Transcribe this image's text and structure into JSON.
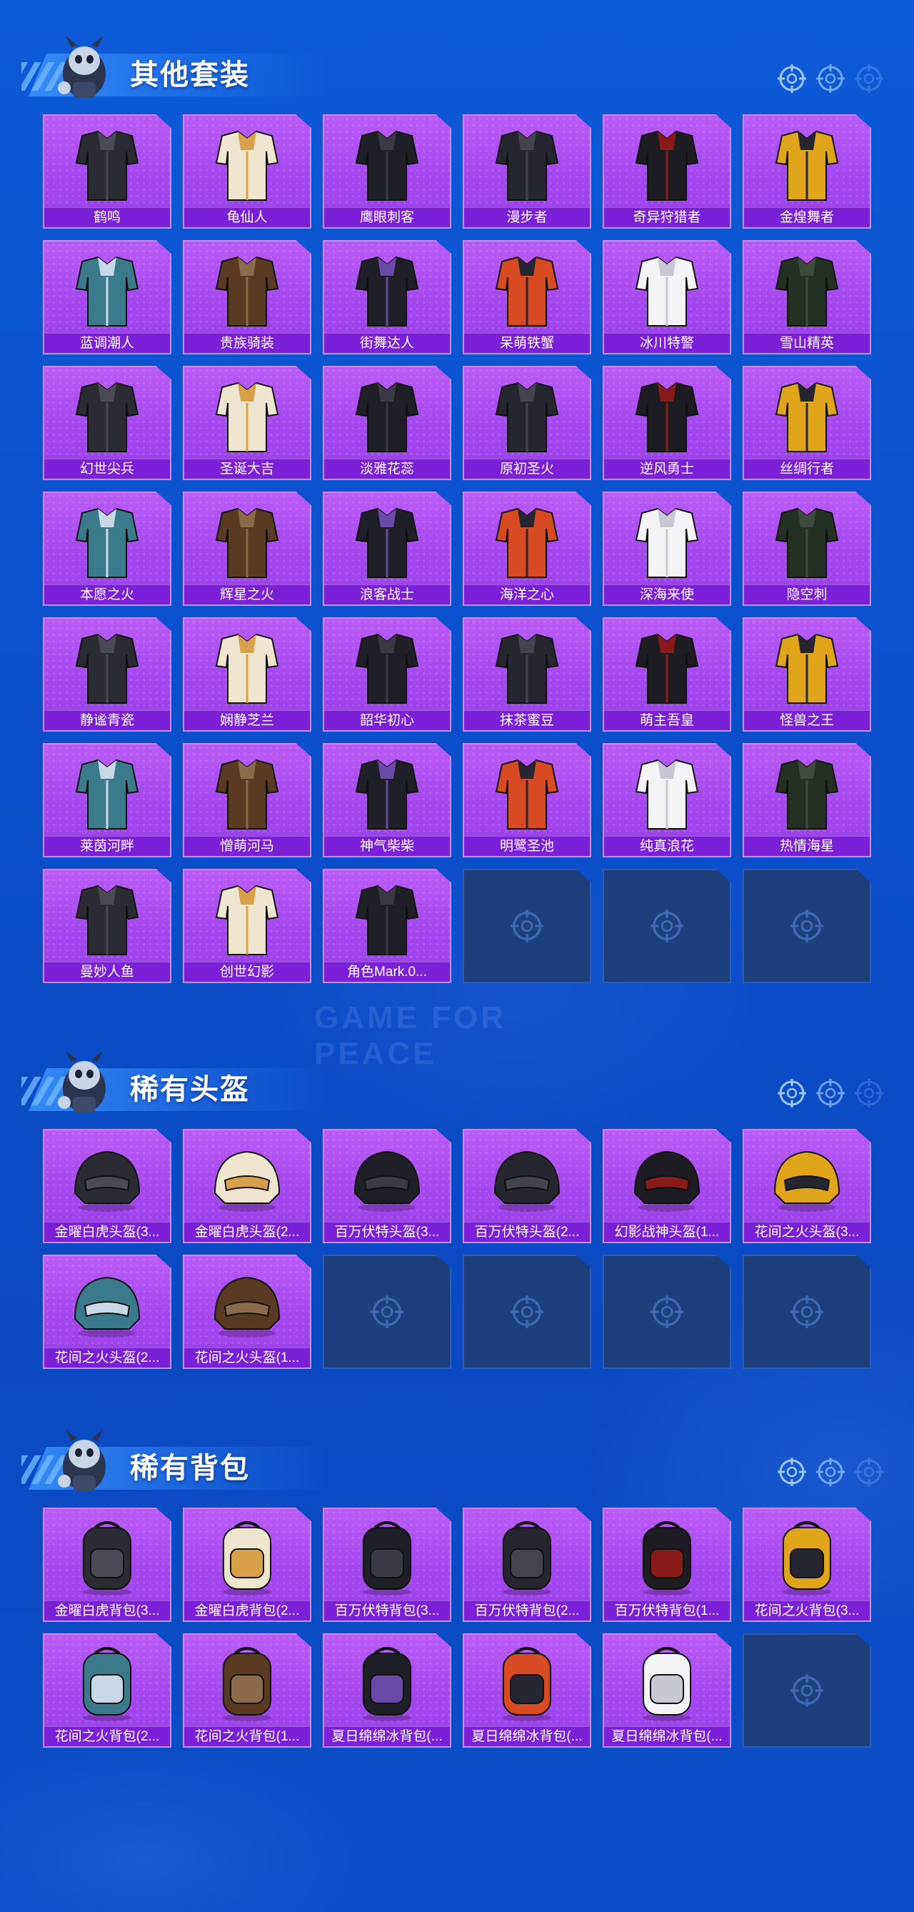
{
  "colors": {
    "background": "#0b4fcd",
    "card_bg": "#a448ee",
    "card_label_bg": "#7b1fd8",
    "card_border": "#c88cff",
    "empty_slot_bg": "#1d3f7c",
    "title_text": "#ffffff"
  },
  "sections": [
    {
      "title": "其他套装",
      "icons": [
        "crosshair-icon",
        "crosshair-icon",
        "crosshair-icon"
      ],
      "items": [
        {
          "label": "鹤鸣",
          "icon": "jacket-icon"
        },
        {
          "label": "龟仙人",
          "icon": "shirt-icon"
        },
        {
          "label": "鹰眼刺客",
          "icon": "outfit-icon"
        },
        {
          "label": "漫步者",
          "icon": "outfit-icon"
        },
        {
          "label": "奇异狩猎者",
          "icon": "outfit-icon"
        },
        {
          "label": "金煌舞者",
          "icon": "outfit-icon"
        },
        {
          "label": "蓝调潮人",
          "icon": "outfit-icon"
        },
        {
          "label": "贵族骑装",
          "icon": "outfit-icon"
        },
        {
          "label": "街舞达人",
          "icon": "outfit-icon"
        },
        {
          "label": "呆萌铁蟹",
          "icon": "outfit-icon"
        },
        {
          "label": "冰川特警",
          "icon": "outfit-icon"
        },
        {
          "label": "雪山精英",
          "icon": "outfit-icon"
        },
        {
          "label": "幻世尖兵",
          "icon": "outfit-icon"
        },
        {
          "label": "圣诞大吉",
          "icon": "outfit-icon"
        },
        {
          "label": "淡雅花蕊",
          "icon": "outfit-icon"
        },
        {
          "label": "原初圣火",
          "icon": "outfit-icon"
        },
        {
          "label": "逆风勇士",
          "icon": "outfit-icon"
        },
        {
          "label": "丝绸行者",
          "icon": "outfit-icon"
        },
        {
          "label": "本愿之火",
          "icon": "outfit-icon"
        },
        {
          "label": "辉星之火",
          "icon": "outfit-icon"
        },
        {
          "label": "浪客战士",
          "icon": "outfit-icon"
        },
        {
          "label": "海洋之心",
          "icon": "outfit-icon"
        },
        {
          "label": "深海来使",
          "icon": "outfit-icon"
        },
        {
          "label": "隐空刺",
          "icon": "outfit-icon"
        },
        {
          "label": "静谧青瓷",
          "icon": "outfit-icon"
        },
        {
          "label": "娴静芝兰",
          "icon": "outfit-icon"
        },
        {
          "label": "韶华初心",
          "icon": "outfit-icon"
        },
        {
          "label": "抹茶蜜豆",
          "icon": "outfit-icon"
        },
        {
          "label": "萌主吾皇",
          "icon": "outfit-icon"
        },
        {
          "label": "怪兽之王",
          "icon": "outfit-icon"
        },
        {
          "label": "莱茵河畔",
          "icon": "outfit-icon"
        },
        {
          "label": "憎萌河马",
          "icon": "outfit-icon"
        },
        {
          "label": "神气柴柴",
          "icon": "outfit-icon"
        },
        {
          "label": "明鹭圣池",
          "icon": "outfit-icon"
        },
        {
          "label": "纯真浪花",
          "icon": "outfit-icon"
        },
        {
          "label": "热情海星",
          "icon": "outfit-icon"
        },
        {
          "label": "曼妙人鱼",
          "icon": "outfit-icon"
        },
        {
          "label": "创世幻影",
          "icon": "outfit-icon"
        },
        {
          "label": "角色Mark.0...",
          "icon": "outfit-icon"
        }
      ],
      "empty_slots": 3
    },
    {
      "title": "稀有头盔",
      "icons": [
        "crosshair-icon",
        "crosshair-icon",
        "crosshair-icon"
      ],
      "items": [
        {
          "label": "金曜白虎头盔(3...",
          "icon": "helmet-icon"
        },
        {
          "label": "金曜白虎头盔(2...",
          "icon": "helmet-icon"
        },
        {
          "label": "百万伏特头盔(3...",
          "icon": "helmet-icon"
        },
        {
          "label": "百万伏特头盔(2...",
          "icon": "helmet-icon"
        },
        {
          "label": "幻影战神头盔(1...",
          "icon": "helmet-icon"
        },
        {
          "label": "花间之火头盔(3...",
          "icon": "helmet-icon"
        },
        {
          "label": "花间之火头盔(2...",
          "icon": "helmet-icon"
        },
        {
          "label": "花间之火头盔(1...",
          "icon": "helmet-icon"
        }
      ],
      "empty_slots": 4
    },
    {
      "title": "稀有背包",
      "icons": [
        "crosshair-icon",
        "crosshair-icon",
        "crosshair-icon"
      ],
      "items": [
        {
          "label": "金曜白虎背包(3...",
          "icon": "backpack-icon"
        },
        {
          "label": "金曜白虎背包(2...",
          "icon": "backpack-icon"
        },
        {
          "label": "百万伏特背包(3...",
          "icon": "backpack-icon"
        },
        {
          "label": "百万伏特背包(2...",
          "icon": "backpack-icon"
        },
        {
          "label": "百万伏特背包(1...",
          "icon": "backpack-icon"
        },
        {
          "label": "花间之火背包(3...",
          "icon": "backpack-icon"
        },
        {
          "label": "花间之火背包(2...",
          "icon": "backpack-icon"
        },
        {
          "label": "花间之火背包(1...",
          "icon": "backpack-icon"
        },
        {
          "label": "夏日绵绵冰背包(...",
          "icon": "backpack-icon"
        },
        {
          "label": "夏日绵绵冰背包(...",
          "icon": "backpack-icon"
        },
        {
          "label": "夏日绵绵冰背包(...",
          "icon": "backpack-icon"
        }
      ],
      "empty_slots": 1
    }
  ],
  "watermark": "GAME FOR PEACE"
}
